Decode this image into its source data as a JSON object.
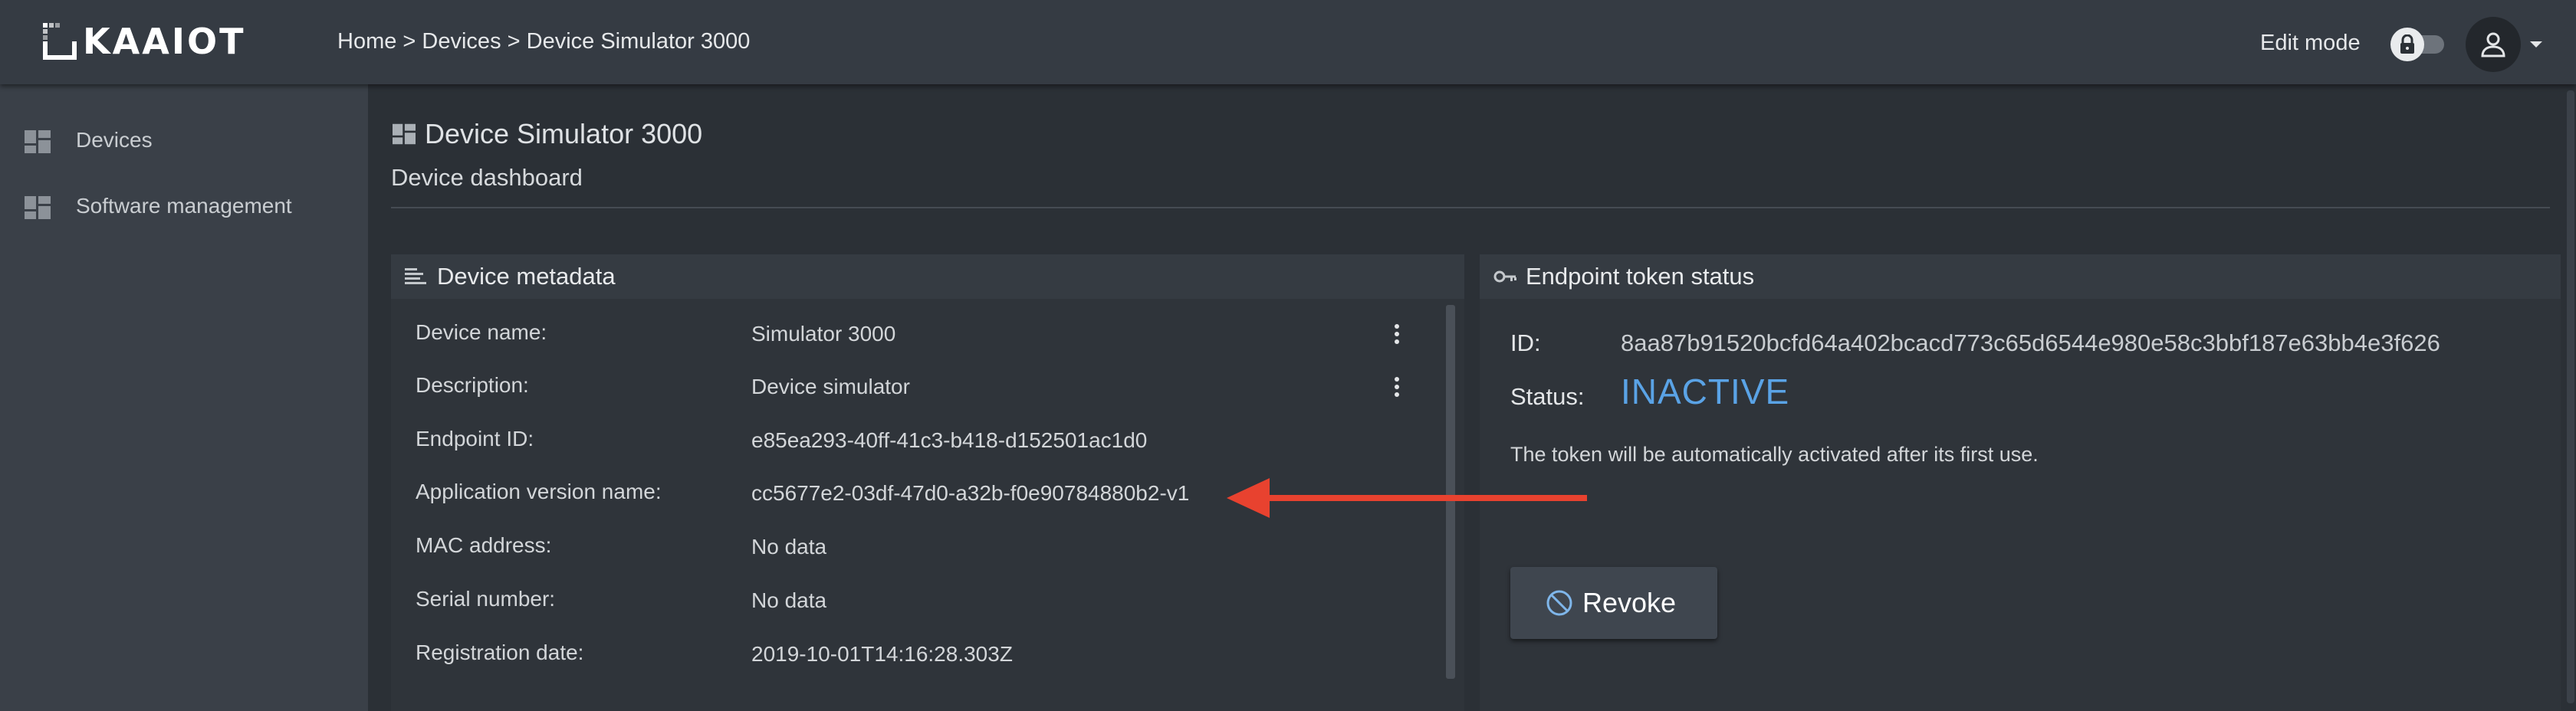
{
  "header": {
    "logo_text": "KAAIOT",
    "breadcrumb": [
      {
        "label": "Home"
      },
      {
        "label": "Devices"
      },
      {
        "label": "Device Simulator 3000"
      }
    ],
    "breadcrumb_separator": " > ",
    "edit_mode_label": "Edit mode"
  },
  "sidebar": {
    "items": [
      {
        "label": "Devices",
        "icon": "dashboard-icon"
      },
      {
        "label": "Software management",
        "icon": "dashboard-icon"
      }
    ]
  },
  "page": {
    "title": "Device Simulator 3000",
    "subtitle": "Device dashboard"
  },
  "metadata": {
    "title": "Device metadata",
    "rows": [
      {
        "label": "Device name:",
        "value": "Simulator 3000",
        "editable": true
      },
      {
        "label": "Description:",
        "value": "Device simulator",
        "editable": true
      },
      {
        "label": "Endpoint ID:",
        "value": "e85ea293-40ff-41c3-b418-d152501ac1d0",
        "editable": false
      },
      {
        "label": "Application version name:",
        "value": "cc5677e2-03df-47d0-a32b-f0e90784880b2-v1",
        "editable": false
      },
      {
        "label": "MAC address:",
        "value": "No data",
        "editable": false
      },
      {
        "label": "Serial number:",
        "value": "No data",
        "editable": false
      },
      {
        "label": "Registration date:",
        "value": "2019-10-01T14:16:28.303Z",
        "editable": false
      }
    ]
  },
  "token": {
    "title": "Endpoint token status",
    "id_label": "ID:",
    "id_value": "8aa87b91520bcfd64a402bcacd773c65d6544e980e58c3bbf187e63bb4e3f626",
    "status_label": "Status:",
    "status_value": "INACTIVE",
    "note": "The token will be automatically activated after its first use.",
    "revoke_label": "Revoke"
  },
  "colors": {
    "status_inactive": "#5aa3e6",
    "annotation_arrow": "#e8422f"
  }
}
